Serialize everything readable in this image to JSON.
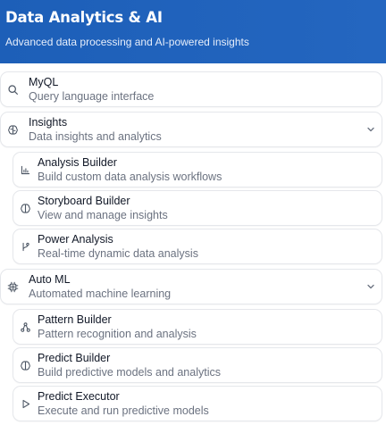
{
  "header": {
    "title": "Data Analytics & AI",
    "subtitle": "Advanced data processing and AI-powered insights"
  },
  "items": [
    {
      "title": "MyQL",
      "description": "Query language interface",
      "icon": "search-icon"
    },
    {
      "title": "Insights",
      "description": "Data insights and analytics",
      "icon": "brain-icon",
      "expanded": true,
      "children": [
        {
          "title": "Analysis Builder",
          "description": "Build custom data analysis workflows",
          "icon": "bar-chart-icon"
        },
        {
          "title": "Storyboard Builder",
          "description": "View and manage insights",
          "icon": "brain-icon"
        },
        {
          "title": "Power Analysis",
          "description": "Real-time dynamic data analysis",
          "icon": "git-branch-icon"
        }
      ]
    },
    {
      "title": "Auto ML",
      "description": "Automated machine learning",
      "icon": "cpu-icon",
      "expanded": true,
      "children": [
        {
          "title": "Pattern Builder",
          "description": "Pattern recognition and analysis",
          "icon": "workflow-icon"
        },
        {
          "title": "Predict Builder",
          "description": "Build predictive models and analytics",
          "icon": "brain-icon"
        },
        {
          "title": "Predict Executor",
          "description": "Execute and run predictive models",
          "icon": "play-icon"
        }
      ]
    }
  ]
}
